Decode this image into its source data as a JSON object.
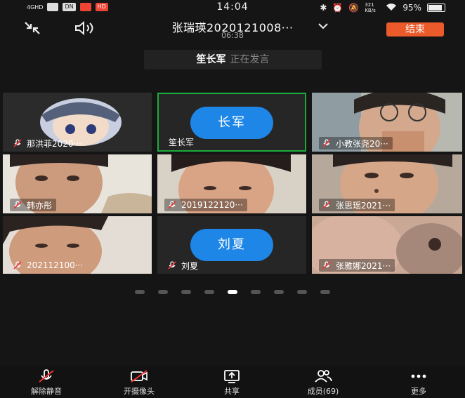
{
  "status_bar": {
    "network": "4GHD",
    "app_chips": [
      "DN",
      "HD"
    ],
    "time": "14:04",
    "speed": "321 KB/s",
    "battery": "95%"
  },
  "topbar": {
    "title": "张瑞瑛2020121008···",
    "duration": "06:38",
    "end_label": "结束"
  },
  "speaking": {
    "name": "笙长军",
    "status": "正在发言"
  },
  "participants": [
    {
      "name": "那洪菲2020···",
      "type": "avatar-photo"
    },
    {
      "name": "笙长军",
      "type": "bubble",
      "bubble": "长军",
      "active": true
    },
    {
      "name": "小教张尧20···",
      "type": "video"
    },
    {
      "name": "韩亦彤",
      "type": "video"
    },
    {
      "name": "2019122120···",
      "type": "video"
    },
    {
      "name": "张思瑶2021···",
      "type": "video"
    },
    {
      "name": "202112100···",
      "type": "video"
    },
    {
      "name": "刘夏",
      "type": "bubble",
      "bubble": "刘夏"
    },
    {
      "name": "张雅娜2021···",
      "type": "video"
    }
  ],
  "pagination": {
    "pages": 9,
    "current": 4
  },
  "bottombar": {
    "items": [
      {
        "label": "解除静音",
        "icon": "mic-muted-icon"
      },
      {
        "label": "开摄像头",
        "icon": "camera-off-icon"
      },
      {
        "label": "共享",
        "icon": "share-screen-icon"
      },
      {
        "label": "成员(69)",
        "icon": "members-icon"
      },
      {
        "label": "更多",
        "icon": "more-icon"
      }
    ]
  },
  "colors": {
    "accent_end": "#ea5a2a",
    "bubble_blue": "#1d86e6",
    "active_border": "#1aad3d"
  }
}
